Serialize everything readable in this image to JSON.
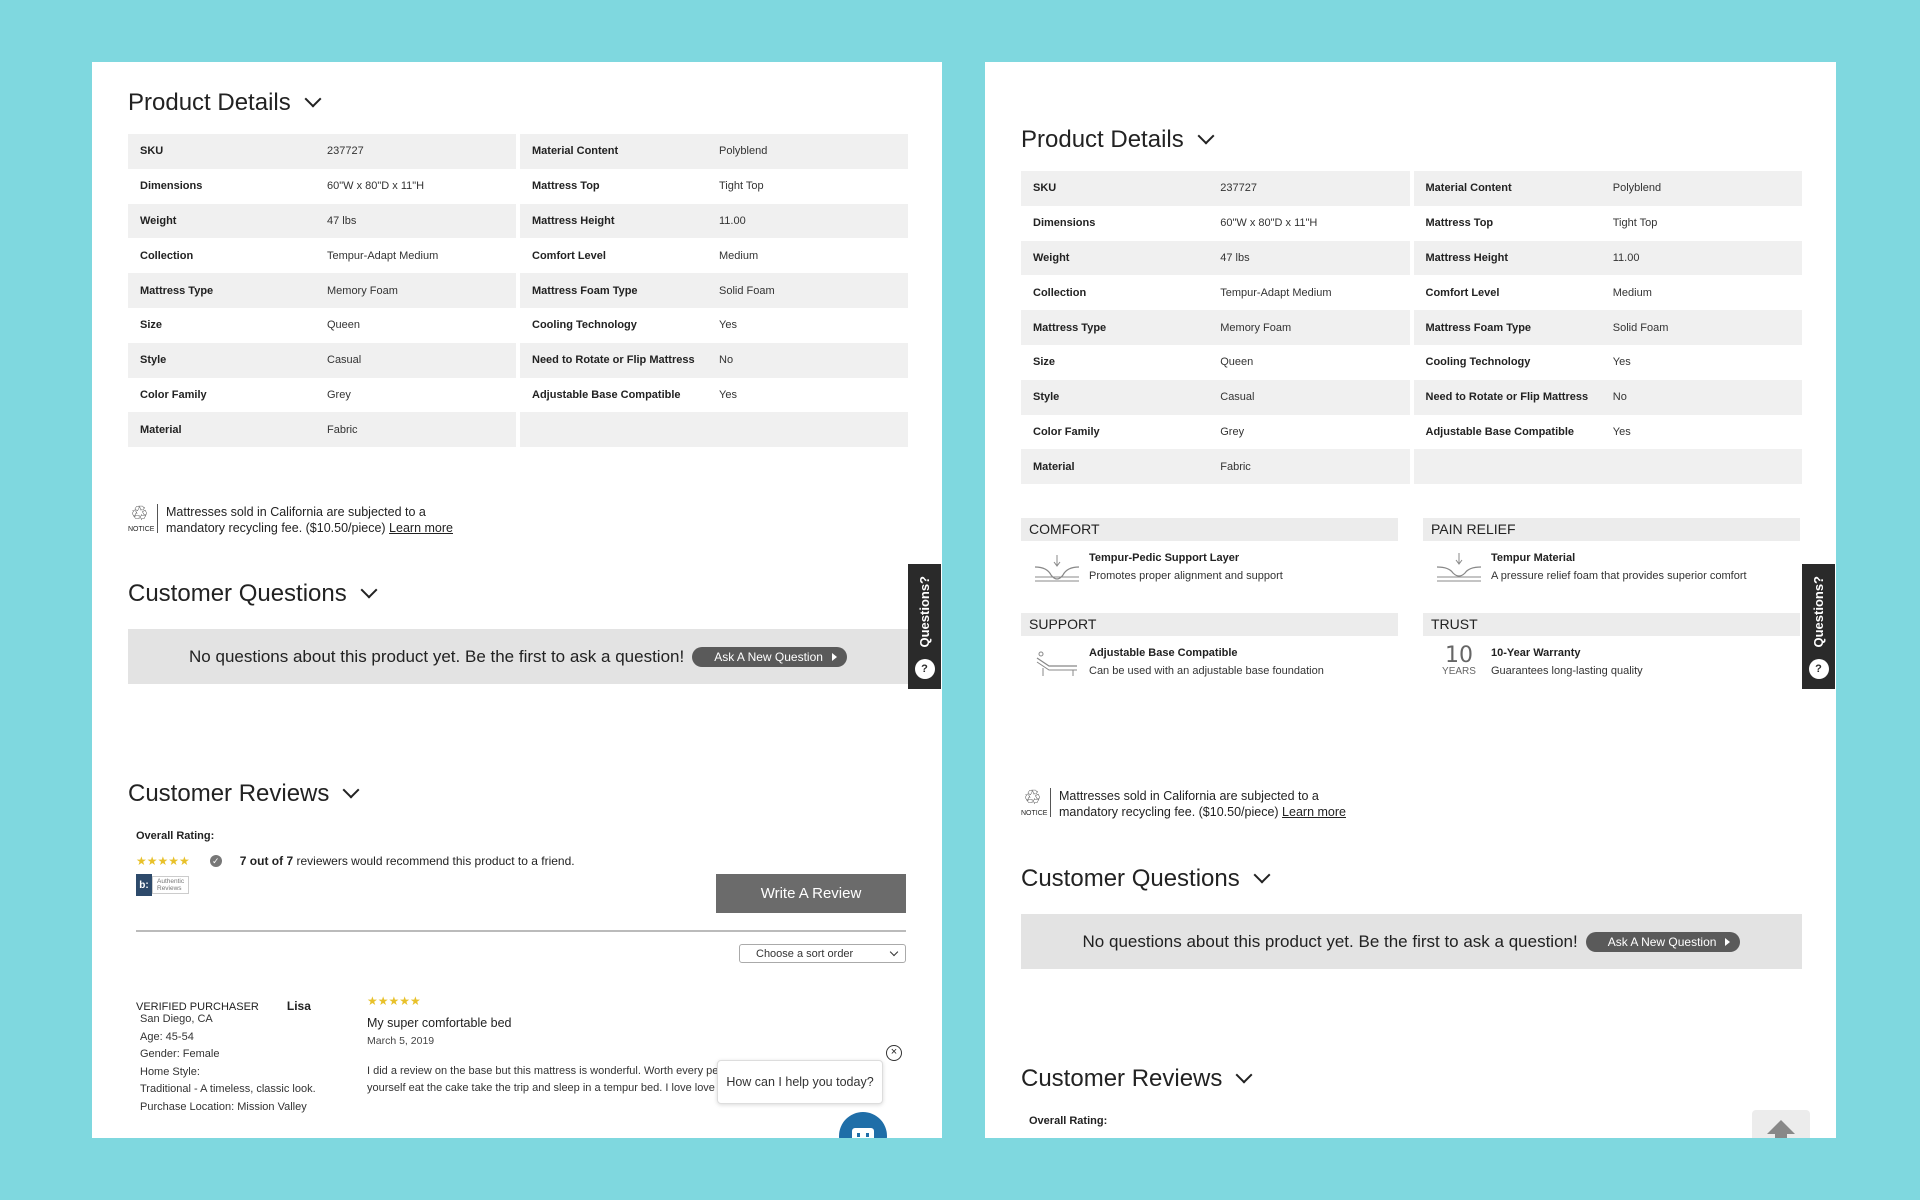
{
  "details": {
    "title": "Product Details",
    "left": [
      {
        "k": "SKU",
        "v": "237727"
      },
      {
        "k": "Dimensions",
        "v": "60\"W x 80\"D x 11\"H"
      },
      {
        "k": "Weight",
        "v": "47 lbs"
      },
      {
        "k": "Collection",
        "v": "Tempur-Adapt Medium"
      },
      {
        "k": "Mattress Type",
        "v": "Memory Foam"
      },
      {
        "k": "Size",
        "v": "Queen"
      },
      {
        "k": "Style",
        "v": "Casual"
      },
      {
        "k": "Color Family",
        "v": "Grey"
      },
      {
        "k": "Material",
        "v": "Fabric"
      }
    ],
    "right": [
      {
        "k": "Material Content",
        "v": "Polyblend"
      },
      {
        "k": "Mattress Top",
        "v": "Tight Top"
      },
      {
        "k": "Mattress Height",
        "v": "11.00"
      },
      {
        "k": "Comfort Level",
        "v": "Medium"
      },
      {
        "k": "Mattress Foam Type",
        "v": "Solid Foam"
      },
      {
        "k": "Cooling Technology",
        "v": "Yes"
      },
      {
        "k": "Need to Rotate or Flip Mattress",
        "v": "No"
      },
      {
        "k": "Adjustable Base Compatible",
        "v": "Yes"
      },
      {
        "k": "",
        "v": ""
      }
    ]
  },
  "notice": {
    "logo_label": "NOTICE",
    "line1": "Mattresses sold in California are subjected to a",
    "line2": "mandatory recycling fee. ($10.50/piece)",
    "link": "Learn more"
  },
  "questions": {
    "title": "Customer Questions",
    "empty_text": "No questions about this product yet. Be the first to ask a question!",
    "ask_button": "Ask A New Question",
    "side_tab": "Questions?"
  },
  "features": [
    {
      "head": "COMFORT",
      "title": "Tempur-Pedic Support Layer",
      "desc": "Promotes proper alignment and support",
      "icon": "support-layer-icon"
    },
    {
      "head": "PAIN RELIEF",
      "title": "Tempur Material",
      "desc": "A pressure relief foam that provides superior comfort",
      "icon": "pressure-foam-icon"
    },
    {
      "head": "SUPPORT",
      "title": "Adjustable Base Compatible",
      "desc": "Can be used with an adjustable base foundation",
      "icon": "adjustable-base-icon"
    },
    {
      "head": "TRUST",
      "title": "10-Year Warranty",
      "desc": "Guarantees long-lasting quality",
      "icon": "warranty-icon",
      "icon_number": "10",
      "icon_label": "YEARS"
    }
  ],
  "reviews": {
    "title": "Customer Reviews",
    "overall_label": "Overall Rating:",
    "stars": "★★★★★",
    "recommend_bold": "7 out of 7",
    "recommend_rest": "reviewers would recommend this product to a friend.",
    "badge_letter": "b:",
    "badge_line1": "Authentic",
    "badge_line2": "Reviews",
    "write_button": "Write A Review",
    "sort_placeholder": "Choose a sort order",
    "review": {
      "badge": "VERIFIED PURCHASER",
      "name": "Lisa",
      "location": "San Diego, CA",
      "age": "Age: 45-54",
      "gender": "Gender: Female",
      "home_style_label": "Home Style:",
      "home_style": "Traditional - A timeless, classic look.",
      "purchase_location": "Purchase Location: Mission Valley",
      "stars": "★★★★★",
      "title": "My super comfortable bed",
      "date": "March 5, 2019",
      "body_line1": "I did a review on the base but this mattress is wonderful. Worth every pen",
      "body_line2": "yourself eat the cake take the trip and sleep in a tempur bed. I love love t"
    }
  },
  "chat": {
    "prompt": "How can I help you today?",
    "close": "×"
  },
  "colors": {
    "background": "#7fd8df",
    "star": "#e8c12a",
    "chat_avatar": "#1f6ea8",
    "button_dark": "#5a5a5a"
  }
}
